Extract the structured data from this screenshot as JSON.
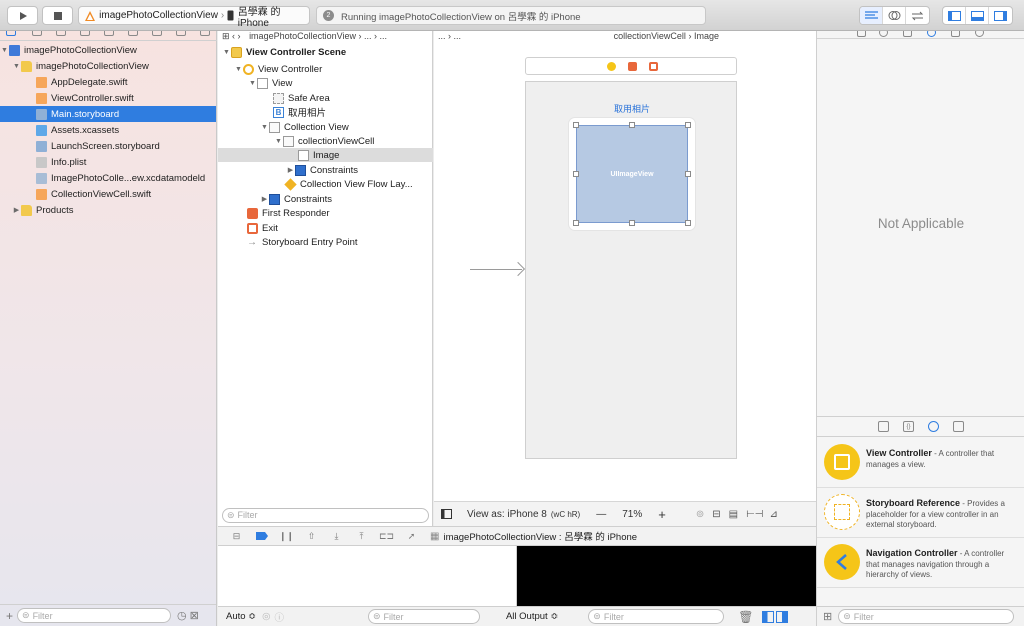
{
  "toolbar": {
    "scheme_name": "imagePhotoCollectionView",
    "device_name": "呂學霖 的 iPhone",
    "activity_text": "Running imagePhotoCollectionView on 呂學霖 的 iPhone",
    "activity_count": "2"
  },
  "navigator": {
    "items": [
      {
        "label": "imagePhotoCollectionView"
      },
      {
        "label": "imagePhotoCollectionView"
      },
      {
        "label": "AppDelegate.swift"
      },
      {
        "label": "ViewController.swift"
      },
      {
        "label": "Main.storyboard"
      },
      {
        "label": "Assets.xcassets"
      },
      {
        "label": "LaunchScreen.storyboard"
      },
      {
        "label": "Info.plist"
      },
      {
        "label": "ImagePhotoColle...ew.xcdatamodeld"
      },
      {
        "label": "CollectionViewCell.swift"
      },
      {
        "label": "Products"
      }
    ],
    "filter_placeholder": "Filter"
  },
  "jumpbar": {
    "crumbs": [
      "imagePhotoCollectionView",
      "...",
      "...",
      "...",
      "...",
      "collectionViewCell",
      "Image"
    ]
  },
  "outline": {
    "items": [
      {
        "label": "View Controller Scene"
      },
      {
        "label": "View Controller"
      },
      {
        "label": "View"
      },
      {
        "label": "Safe Area"
      },
      {
        "label": "取用相片"
      },
      {
        "label": "Collection View"
      },
      {
        "label": "collectionViewCell"
      },
      {
        "label": "Image"
      },
      {
        "label": "Constraints"
      },
      {
        "label": "Collection View Flow Lay..."
      },
      {
        "label": "Constraints"
      },
      {
        "label": "First Responder"
      },
      {
        "label": "Exit"
      },
      {
        "label": "Storyboard Entry Point"
      }
    ],
    "filter_placeholder": "Filter"
  },
  "canvas": {
    "button_title": "取用相片",
    "image_view_label": "UIImageView",
    "view_as": "View as: iPhone 8",
    "size_class": "(wC hR)",
    "zoom_minus": "—",
    "zoom": "71%",
    "zoom_plus": "+"
  },
  "debug": {
    "process_label": "imagePhotoCollectionView : 呂學霖 的 iPhone",
    "auto_label": "Auto ≎",
    "filter_placeholder": "Filter",
    "output_label": "All Output ≎",
    "console_filter_placeholder": "Filter"
  },
  "inspector": {
    "not_applicable": "Not Applicable",
    "library": [
      {
        "title": "View Controller",
        "desc": " - A controller that manages a view.",
        "color": "#f5c518"
      },
      {
        "title": "Storyboard Reference",
        "desc": " - Provides a placeholder for a view controller in an external storyboard.",
        "color": "#ffffff"
      },
      {
        "title": "Navigation Controller",
        "desc": " - A controller that manages navigation through a hierarchy of views.",
        "color": "#f5c518"
      }
    ],
    "filter_placeholder": "Filter"
  },
  "colors": {
    "selection": "#2f7de0",
    "image_view_fill": "#b6c9e3",
    "accent_blue": "#2a73d9"
  }
}
